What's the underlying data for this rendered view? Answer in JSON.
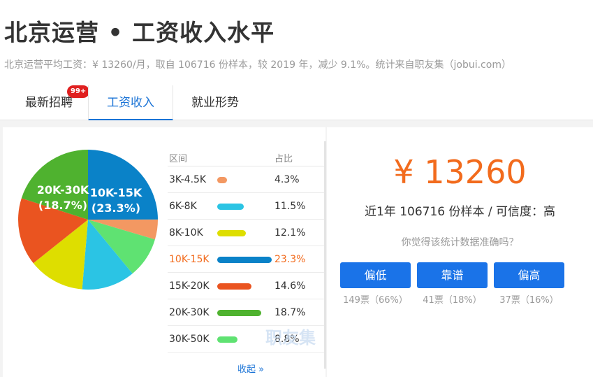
{
  "title": "北京运营 • 工资收入水平",
  "summary": "北京运营平均工资：¥ 13260/月，取自 106716 份样本，较 2019 年，减少 9.1%。统计来自职友集（jobui.com）",
  "tabs": [
    {
      "label": "最新招聘",
      "badge": "99+"
    },
    {
      "label": "工资收入"
    },
    {
      "label": "就业形势"
    }
  ],
  "table": {
    "header_range": "区间",
    "header_share": "占比",
    "rows": [
      {
        "range": "3K-4.5K",
        "pct": "4.3%",
        "value": 4.3,
        "color": "#f39862"
      },
      {
        "range": "6K-8K",
        "pct": "11.5%",
        "value": 11.5,
        "color": "#2bc4e4"
      },
      {
        "range": "8K-10K",
        "pct": "12.1%",
        "value": 12.1,
        "color": "#dede00"
      },
      {
        "range": "10K-15K",
        "pct": "23.3%",
        "value": 23.3,
        "color": "#0a82c8"
      },
      {
        "range": "15K-20K",
        "pct": "14.6%",
        "value": 14.6,
        "color": "#ea5420"
      },
      {
        "range": "20K-30K",
        "pct": "18.7%",
        "value": 18.7,
        "color": "#4fb22f"
      },
      {
        "range": "30K-50K",
        "pct": "8.8%",
        "value": 8.8,
        "color": "#5fe272"
      }
    ],
    "collapse_label": "收起 »",
    "watermark": "职友集"
  },
  "pie_labels": {
    "label_10_15": "10K-15K",
    "pct_10_15": "(23.3%)",
    "label_20_30": "20K-30K",
    "pct_20_30": "(18.7%)"
  },
  "stats": {
    "salary": "¥ 13260",
    "sample": "近1年 106716 份样本 / 可信度：高",
    "question": "你觉得该统计数据准确吗？",
    "votes": [
      {
        "label": "偏低",
        "count": "149票（66%）"
      },
      {
        "label": "靠谱",
        "count": "41票（18%）"
      },
      {
        "label": "偏高",
        "count": "37票（16%）"
      }
    ]
  },
  "chart_data": {
    "type": "pie",
    "categories": [
      "10K-15K",
      "3K-4.5K",
      "30K-50K",
      "6K-8K",
      "8K-10K",
      "15K-20K",
      "20K-30K"
    ],
    "values": [
      23.3,
      4.3,
      8.8,
      11.5,
      12.1,
      14.6,
      18.7
    ],
    "colors": [
      "#0a82c8",
      "#f39862",
      "#5fe272",
      "#2bc4e4",
      "#dede00",
      "#ea5420",
      "#4fb22f"
    ]
  }
}
